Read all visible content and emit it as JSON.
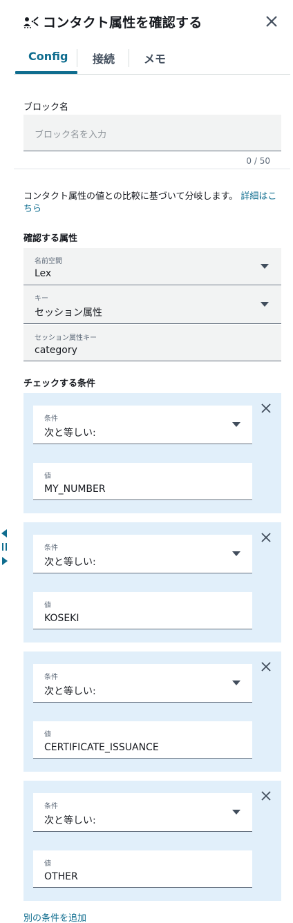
{
  "header": {
    "title": "コンタクト属性を確認する",
    "icon": "check-attributes-icon"
  },
  "tabs": [
    {
      "label": "Config",
      "active": true
    },
    {
      "label": "接続",
      "active": false
    },
    {
      "label": "メモ",
      "active": false
    }
  ],
  "block_name": {
    "label": "ブロック名",
    "placeholder": "ブロック名を入力",
    "value": "",
    "counter": "0 / 50"
  },
  "description": {
    "text": "コンタクト属性の値との比較に基づいて分岐します。",
    "link_text": "詳細はこちら"
  },
  "attribute": {
    "section_label": "確認する属性",
    "namespace": {
      "label": "名前空間",
      "value": "Lex"
    },
    "key": {
      "label": "キー",
      "value": "セッション属性"
    },
    "session_key": {
      "label": "セッション属性キー",
      "value": "category"
    }
  },
  "conditions": {
    "section_label": "チェックする条件",
    "items": [
      {
        "condition_label": "条件",
        "condition_value": "次と等しい:",
        "value_label": "値",
        "value": "MY_NUMBER"
      },
      {
        "condition_label": "条件",
        "condition_value": "次と等しい:",
        "value_label": "値",
        "value": "KOSEKI"
      },
      {
        "condition_label": "条件",
        "condition_value": "次と等しい:",
        "value_label": "値",
        "value": "CERTIFICATE_ISSUANCE"
      },
      {
        "condition_label": "条件",
        "condition_value": "次と等しい:",
        "value_label": "値",
        "value": "OTHER"
      }
    ],
    "add_label": "別の条件を追加"
  },
  "colors": {
    "accent": "#0f6d8f",
    "condition_bg": "#e1effa",
    "field_bg": "#f2f3f3"
  }
}
